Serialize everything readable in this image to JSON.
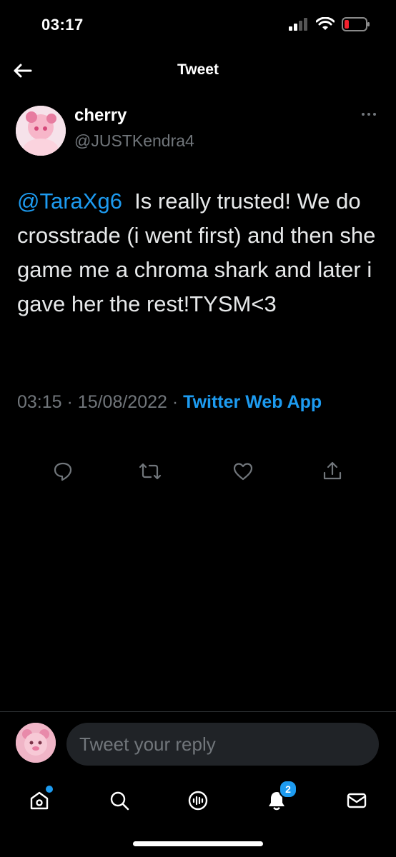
{
  "status_bar": {
    "time": "03:17",
    "icons": [
      "cellular-signal-icon",
      "wifi-icon",
      "battery-low-icon"
    ]
  },
  "header": {
    "title": "Tweet",
    "back_icon": "back-arrow-icon"
  },
  "tweet": {
    "author": {
      "display_name": "cherry",
      "handle": "@JUSTKendra4"
    },
    "mention": "@TaraXg6",
    "text": "Is really trusted! We do crosstrade (i went first) and then she game me a chroma shark and later i gave her the rest!TYSM<3",
    "time": "03:15",
    "separator": "·",
    "date": "15/08/2022",
    "client": "Twitter Web App",
    "actions": [
      "reply-icon",
      "retweet-icon",
      "like-icon",
      "share-icon"
    ]
  },
  "reply": {
    "placeholder": "Tweet your reply"
  },
  "bottom_nav": {
    "items": [
      "home-icon",
      "search-icon",
      "spaces-icon",
      "notifications-icon",
      "messages-icon"
    ],
    "notifications_count": "2"
  },
  "colors": {
    "background": "#000000",
    "accent": "#1d9bf0",
    "muted_text": "#71767b",
    "battery_low": "#f4212e"
  }
}
